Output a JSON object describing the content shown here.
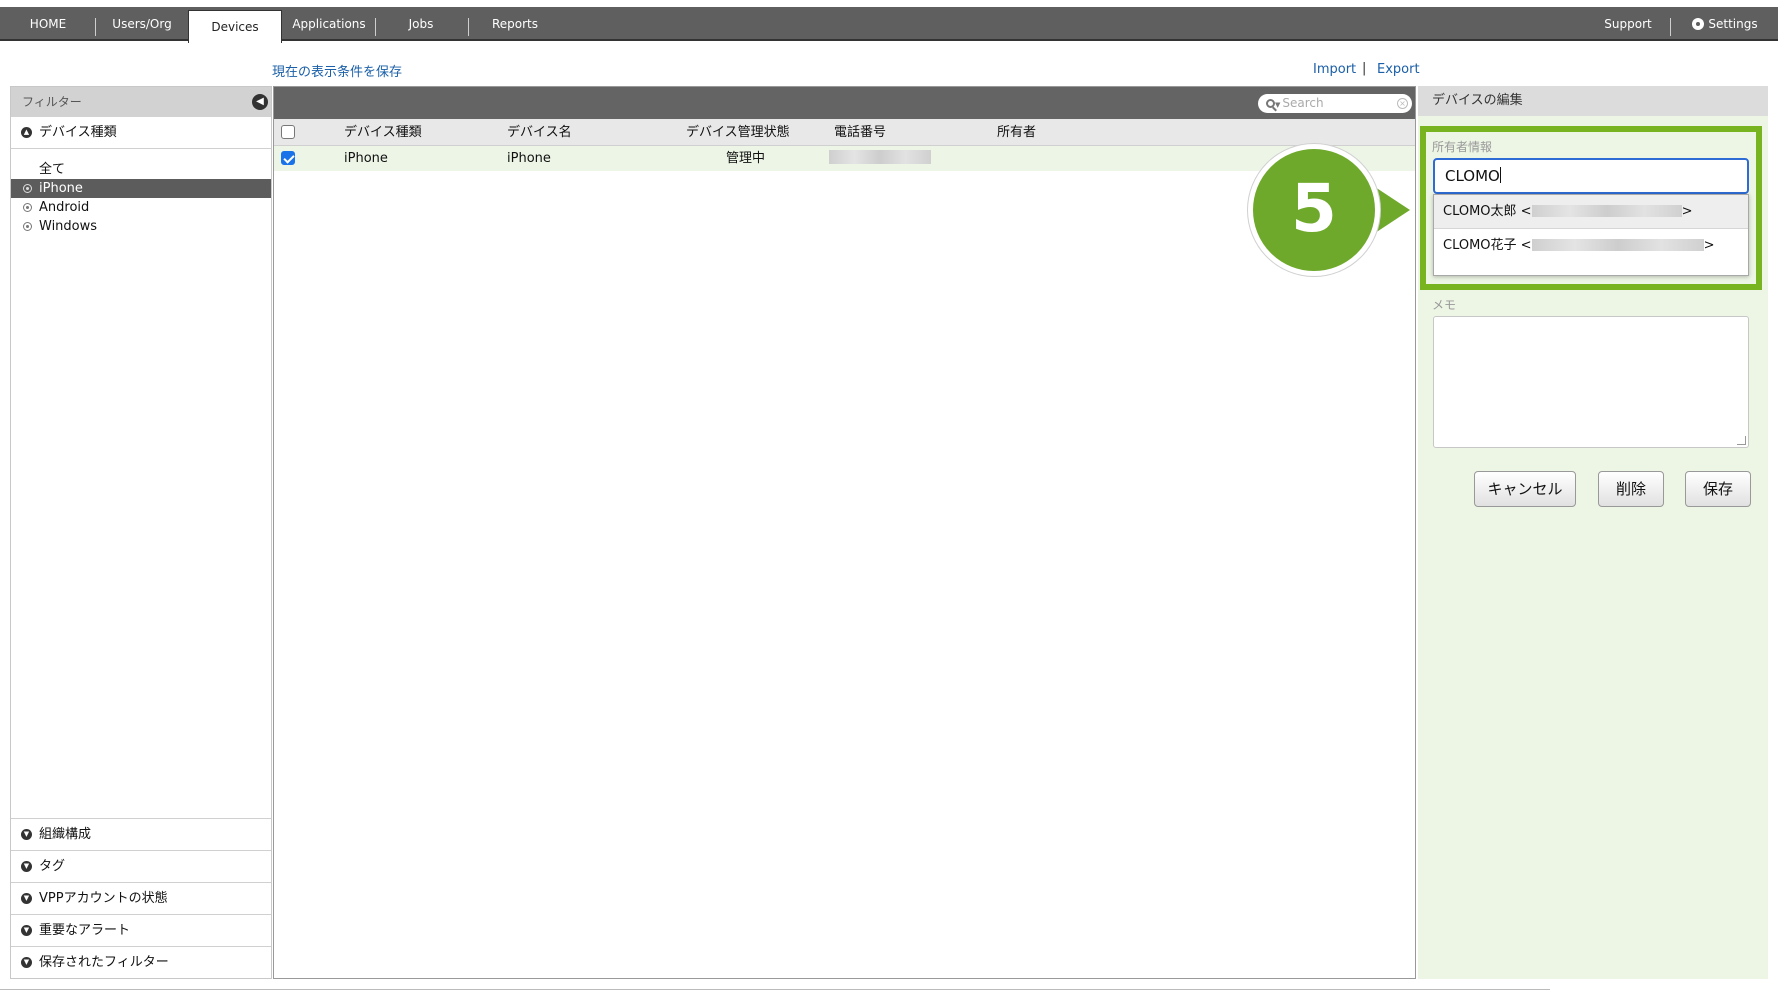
{
  "nav": {
    "tabs": [
      {
        "label": "HOME"
      },
      {
        "label": "Users/Org"
      },
      {
        "label": "Devices"
      },
      {
        "label": "Applications"
      },
      {
        "label": "Jobs"
      },
      {
        "label": "Reports"
      }
    ],
    "support": "Support",
    "settings": "Settings"
  },
  "toolbar": {
    "save_view": "現在の表示条件を保存",
    "import": "Import",
    "sep": "|",
    "export": "Export"
  },
  "filter": {
    "title": "フィルター",
    "device_type_header": "デバイス種類",
    "items": [
      {
        "label": "全て"
      },
      {
        "label": "iPhone"
      },
      {
        "label": "Android"
      },
      {
        "label": "Windows"
      }
    ],
    "bottom_sections": [
      {
        "label": "組織構成"
      },
      {
        "label": "タグ"
      },
      {
        "label": "VPPアカウントの状態"
      },
      {
        "label": "重要なアラート"
      },
      {
        "label": "保存されたフィルター"
      }
    ]
  },
  "table": {
    "search_placeholder": "Search",
    "columns": {
      "type": "デバイス種類",
      "name": "デバイス名",
      "status": "デバイス管理状態",
      "phone": "電話番号",
      "owner": "所有者"
    },
    "rows": [
      {
        "type": "iPhone",
        "name": "iPhone",
        "status": "管理中",
        "phone": "",
        "owner": "",
        "checked": true
      }
    ]
  },
  "edit_panel": {
    "title": "デバイスの編集",
    "owner_label": "所有者情報",
    "owner_value": "CLOMO",
    "suggestions": [
      {
        "prefix": "CLOMO太郎 <",
        "suffix": ">"
      },
      {
        "prefix": "CLOMO花子 <",
        "suffix": ">"
      }
    ],
    "memo_label": "メモ",
    "cancel": "キャンセル",
    "delete": "削除",
    "save": "保存"
  },
  "step_marker": "5",
  "colors": {
    "highlight": "#78b320",
    "nav_bg": "#5f5f5f",
    "link": "#1a5fa8",
    "panel_bg": "#edf5e5"
  }
}
